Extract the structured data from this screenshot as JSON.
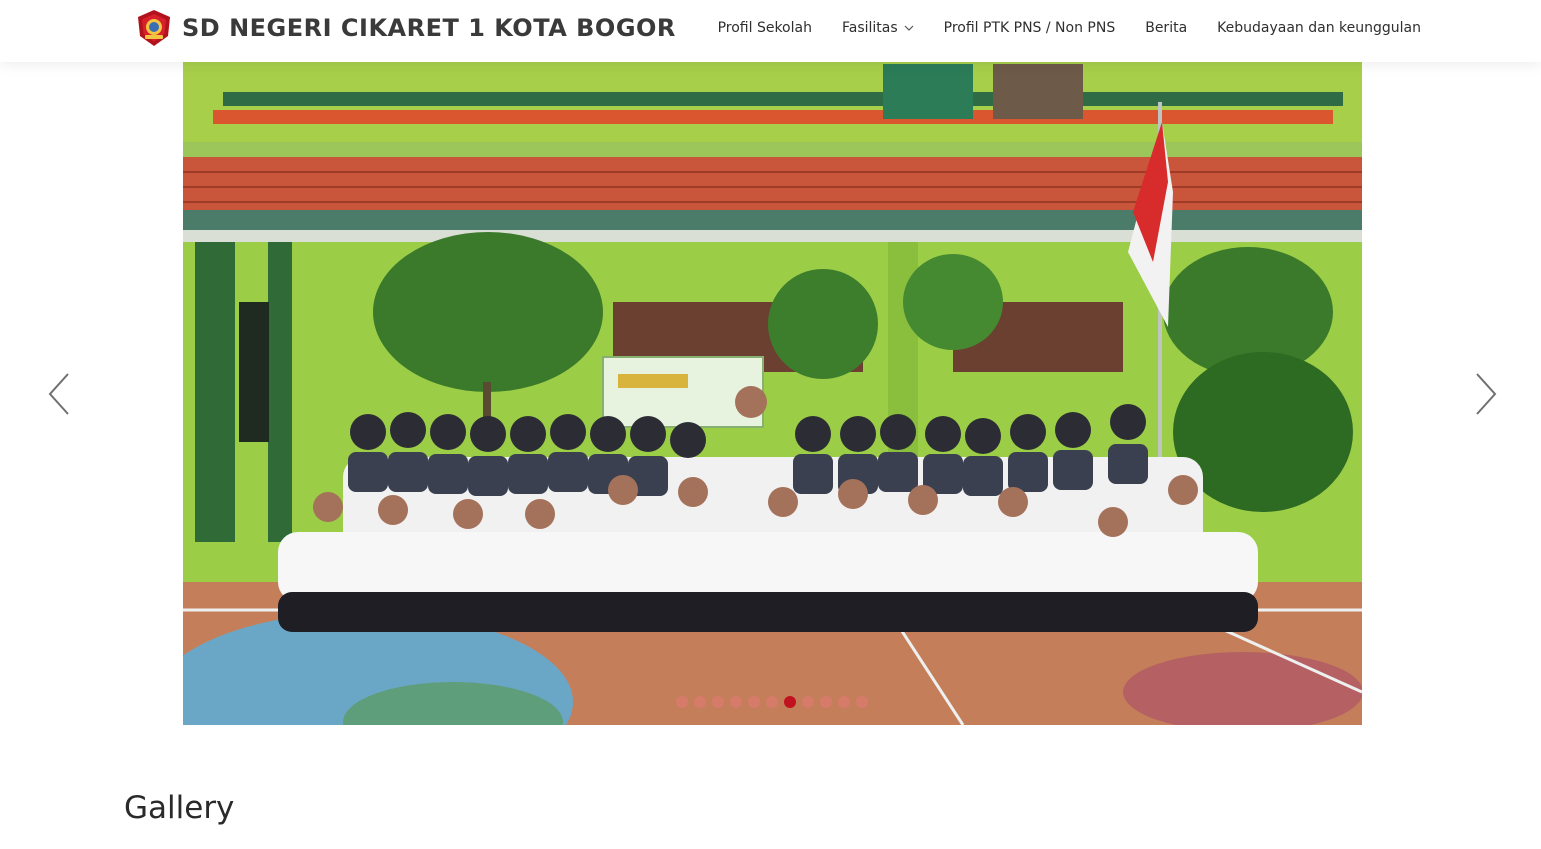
{
  "header": {
    "brand_title": "SD NEGERI CIKARET 1 KOTA BOGOR",
    "logo_icon": "school-crest-icon",
    "nav": [
      {
        "label": "Profil Sekolah"
      },
      {
        "label": "Fasilitas",
        "has_dropdown": true
      },
      {
        "label": "Profil PTK PNS / Non PNS"
      },
      {
        "label": "Berita"
      },
      {
        "label": "Kebudayaan dan keunggulan"
      }
    ]
  },
  "carousel": {
    "slide_count": 11,
    "active_index": 6,
    "prev_icon": "chevron-left-icon",
    "next_icon": "chevron-right-icon",
    "slide_image": "group-photo-school-staff"
  },
  "gallery": {
    "title": "Gallery"
  },
  "colors": {
    "accent": "#c1121f",
    "text": "#2f2f2f",
    "indicator_inactive": "#e87878"
  }
}
